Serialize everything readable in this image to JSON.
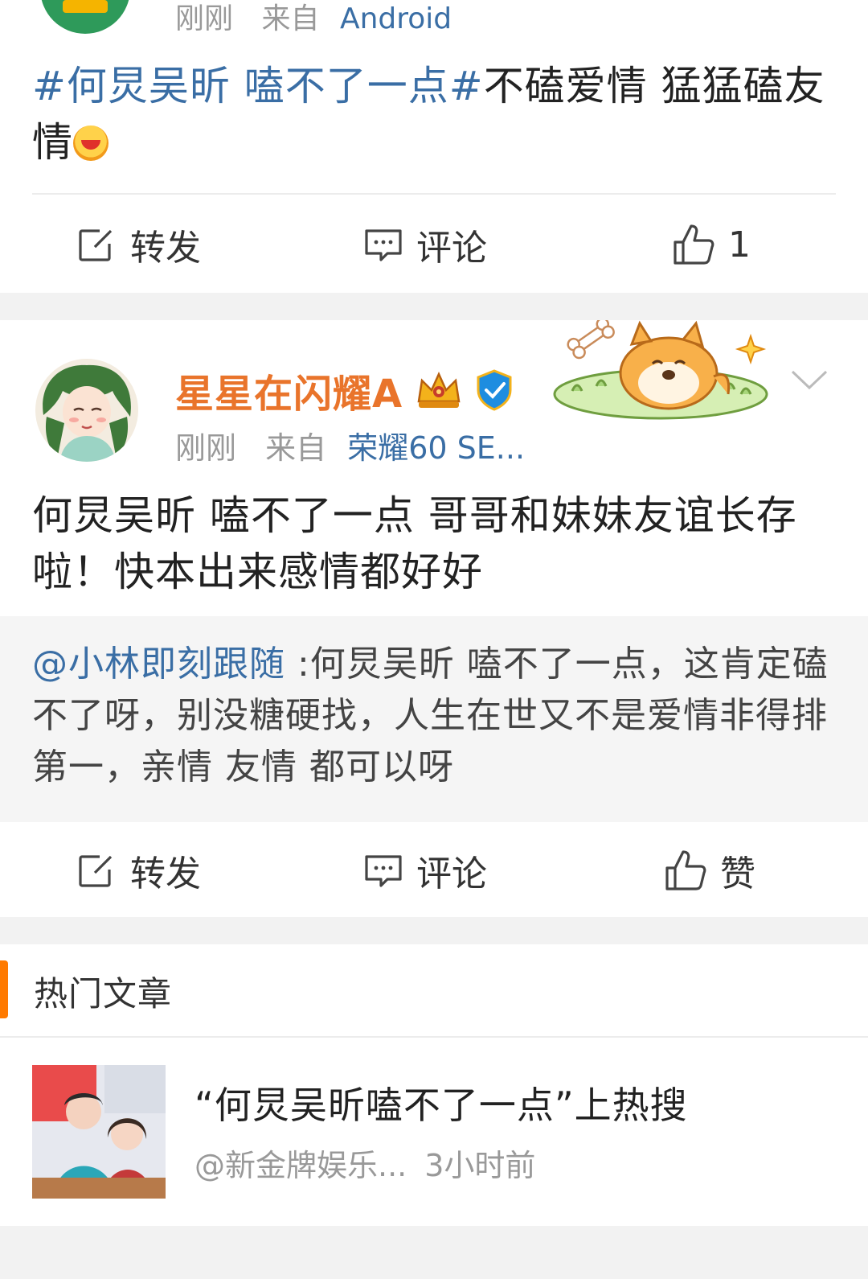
{
  "post1": {
    "meta_time": "刚刚",
    "meta_source_prefix": "来自",
    "meta_source": "Android",
    "text_topic": "#何炅吴昕 嗑不了一点#",
    "text_body": "不磕爱情 猛猛磕友情",
    "actions": {
      "repost": "转发",
      "comment": "评论",
      "like_count": "1"
    }
  },
  "post2": {
    "username": "星星在闪耀A",
    "meta_time": "刚刚",
    "meta_source_prefix": "来自",
    "meta_source": "荣耀60 SE...",
    "text": "何炅吴昕 嗑不了一点 哥哥和妹妹友谊长存啦！快本出来感情都好好",
    "quote_mention": "@小林即刻跟随",
    "quote_text": " :何炅吴昕 嗑不了一点，这肯定磕不了呀，别没糖硬找，人生在世又不是爱情非得排第一，亲情 友情 都可以呀",
    "actions": {
      "repost": "转发",
      "comment": "评论",
      "like": "赞"
    }
  },
  "hot_articles": {
    "title": "热门文章",
    "items": [
      {
        "title": "“何炅吴昕嗑不了一点”上热搜",
        "author": "@新金牌娱乐...",
        "time": "3小时前"
      }
    ]
  },
  "colors": {
    "link_blue": "#3a6ea5",
    "username_orange": "#e9742b",
    "accent_orange": "#ff7a00"
  }
}
